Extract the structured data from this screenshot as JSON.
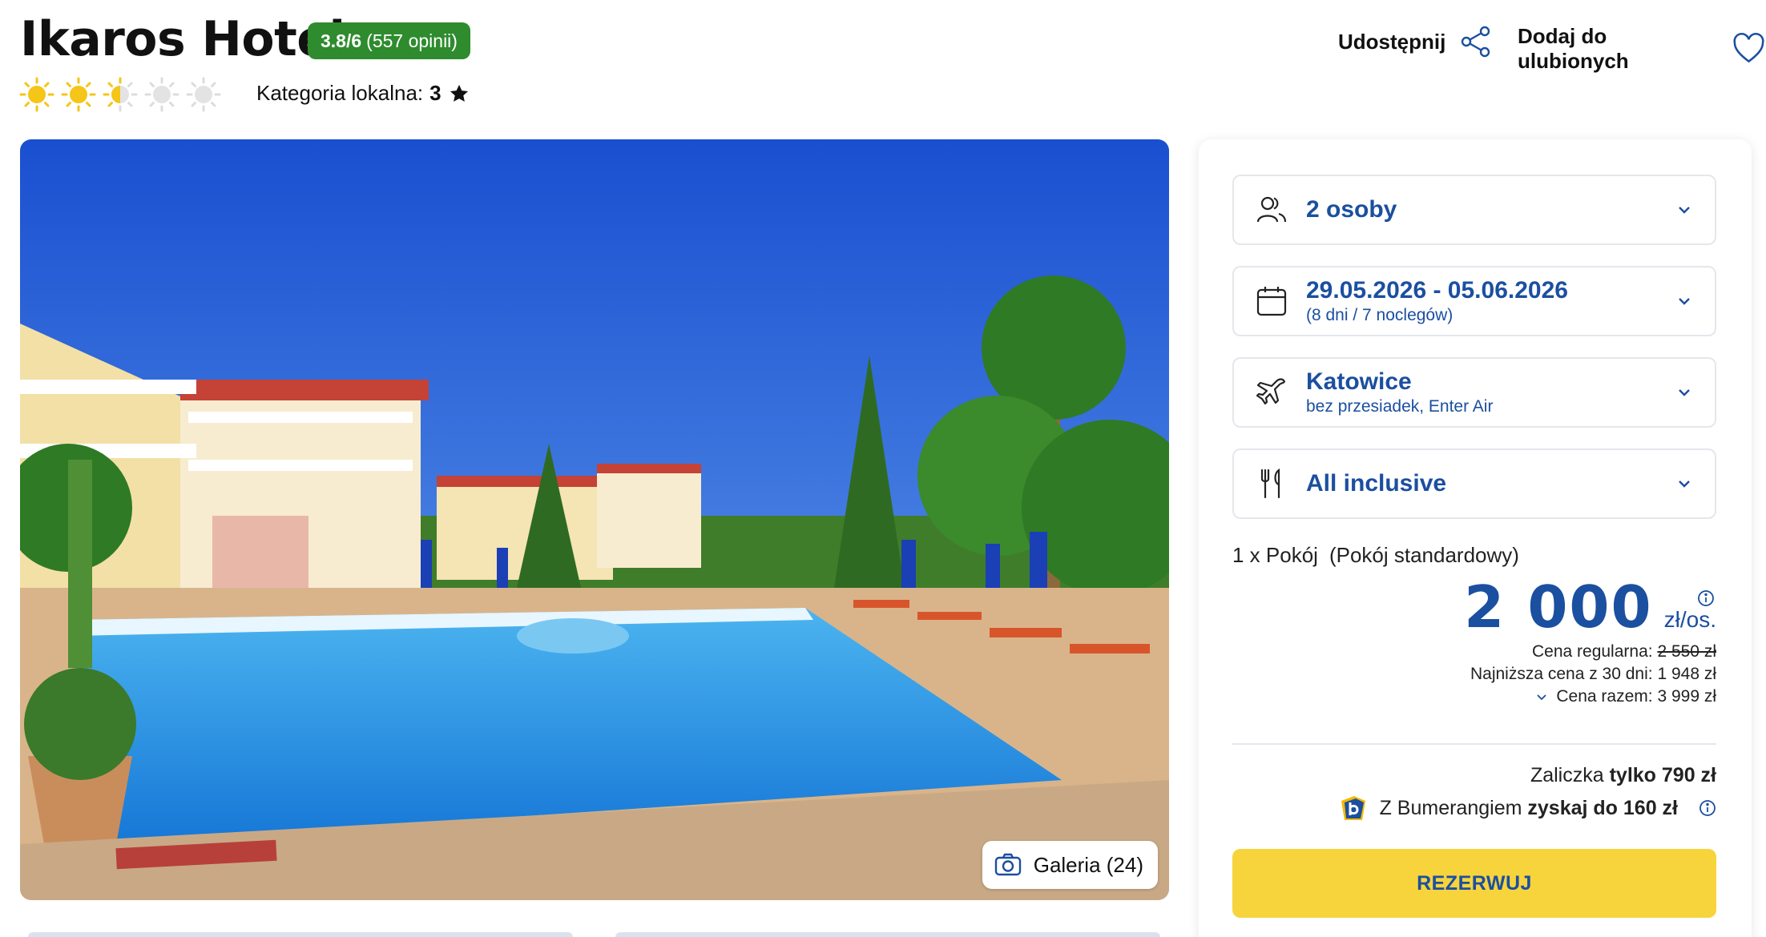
{
  "hotel": {
    "name": "Ikaros Hotel",
    "rating": "3.8/6",
    "reviews": "(557 opinii)",
    "stars_rating": 2.5,
    "stars_max": 5,
    "local_category_label": "Kategoria lokalna:",
    "local_category_value": "3"
  },
  "actions": {
    "share_label": "Udostępnij",
    "favorite_label": "Dodaj do ulubionych"
  },
  "gallery": {
    "label": "Galeria (24)"
  },
  "booking": {
    "persons": {
      "label": "2 osoby",
      "icon": "people-icon"
    },
    "dates": {
      "label": "29.05.2026 - 05.06.2026",
      "sub": "(8 dni / 7 noclegów)",
      "icon": "calendar-icon"
    },
    "flight": {
      "label": "Katowice",
      "sub": "bez przesiadek, Enter Air",
      "icon": "plane-icon"
    },
    "board": {
      "label": "All inclusive",
      "icon": "cutlery-icon"
    },
    "room_qty": "1 x Pokój",
    "room_type": "(Pokój standardowy)",
    "price": "2 000",
    "price_unit": "zł/os.",
    "regular_label": "Cena regularna:",
    "regular_value": "2 550 zł",
    "lowest_30": "Najniższa cena z 30 dni: 1 948 zł",
    "total": "Cena razem: 3 999 zł",
    "deposit_label": "Zaliczka",
    "deposit_value": "tylko 790 zł",
    "bumerang_label": "Z Bumerangiem",
    "bumerang_value": "zyskaj do 160 zł",
    "reserve_label": "REZERWUJ"
  },
  "colors": {
    "brand_blue": "#1b4fa0",
    "rating_green": "#2e8b2e",
    "cta_yellow": "#f7d43b",
    "sun_yellow": "#f5c518"
  }
}
